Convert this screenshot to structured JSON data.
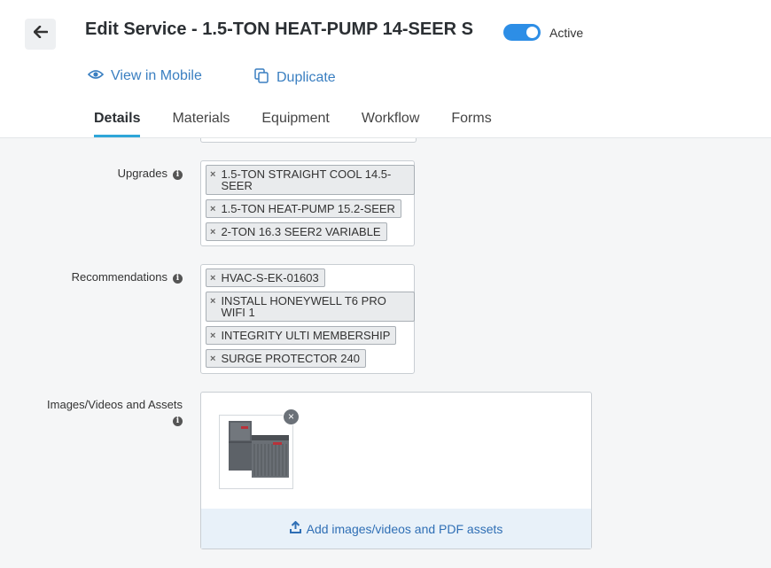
{
  "header": {
    "title": "Edit Service - 1.5-TON HEAT-PUMP 14-SEER S",
    "active_label": "Active",
    "active": true,
    "actions": {
      "view_mobile": "View in Mobile",
      "duplicate": "Duplicate"
    },
    "tabs": [
      {
        "label": "Details",
        "active": true
      },
      {
        "label": "Materials"
      },
      {
        "label": "Equipment"
      },
      {
        "label": "Workflow"
      },
      {
        "label": "Forms"
      }
    ]
  },
  "form": {
    "upgrades": {
      "label": "Upgrades",
      "tags": [
        "1.5-TON STRAIGHT COOL 14.5-SEER",
        "1.5-TON HEAT-PUMP 15.2-SEER",
        "2-TON 16.3 SEER2 VARIABLE"
      ]
    },
    "recommendations": {
      "label": "Recommendations",
      "tags": [
        "HVAC-S-EK-01603",
        "INSTALL HONEYWELL T6 PRO WIFI 1",
        "INTEGRITY ULTI MEMBERSHIP",
        "SURGE PROTECTOR 240"
      ]
    },
    "assets": {
      "label": "Images/Videos and Assets",
      "add_label": "Add images/videos and PDF assets",
      "remove_symbol": "×"
    }
  },
  "colors": {
    "accent": "#2d8ee6",
    "link": "#3a7fc1",
    "tab_underline": "#2fa6d8"
  },
  "icons": {
    "back": "arrow-left-icon",
    "mobile": "eye-icon",
    "duplicate": "copy-icon",
    "info": "info-icon",
    "upload": "upload-icon"
  }
}
